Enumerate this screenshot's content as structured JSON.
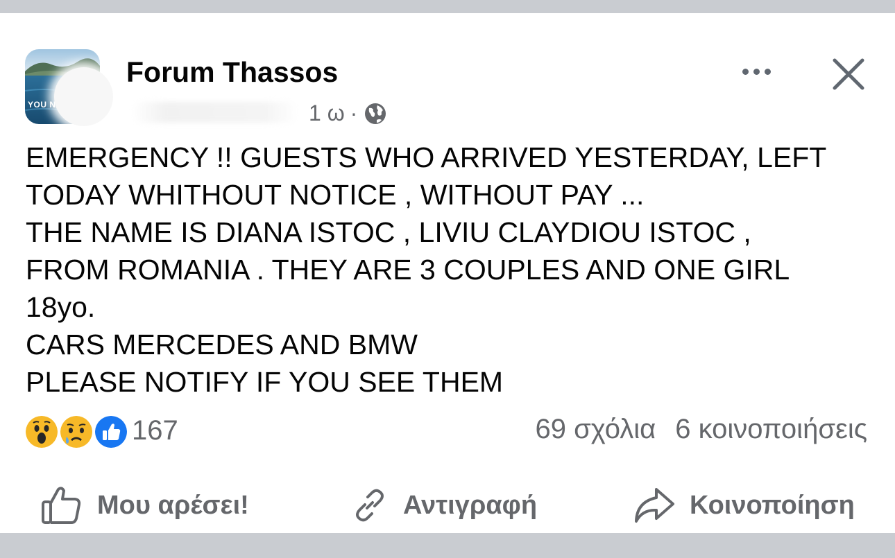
{
  "post": {
    "page_name": "Forum Thassos",
    "avatar_text": "YOU N",
    "time": "1 ω",
    "separator": "·",
    "text": "EMERGENCY !!  GUESTS WHO ARRIVED YESTERDAY, LEFT\nTODAY WHITHOUT NOTICE , WITHOUT PAY ...\nTHE NAME IS DIANA ISTOC , LIVIU CLAYDIOU ISTOC ,\nFROM ROMANIA . THEY ARE 3 COUPLES AND ONE GIRL\n18yo.\nCARS MERCEDES AND BMW\nPLEASE NOTIFY IF YOU SEE THEM"
  },
  "icons": {
    "privacy": "globe-icon",
    "more": "more-dots-icon",
    "close": "close-icon",
    "reactions": [
      "wow-reaction-icon",
      "sad-reaction-icon",
      "like-reaction-icon"
    ],
    "like": "thumbs-up-outline-icon",
    "copy": "link-icon",
    "share": "share-arrow-icon"
  },
  "stats": {
    "reaction_count": "167",
    "comments": "69 σχόλια",
    "shares": "6 κοινοποιήσεις"
  },
  "actions": {
    "like": "Μου αρέσει!",
    "copy": "Αντιγραφή",
    "share": "Κοινοποίηση"
  },
  "colors": {
    "background": "#c9ccd1",
    "card": "#ffffff",
    "text": "#050505",
    "secondary": "#65676b",
    "like_blue": "#1877f2",
    "reaction_yellow": "#f7b928"
  }
}
